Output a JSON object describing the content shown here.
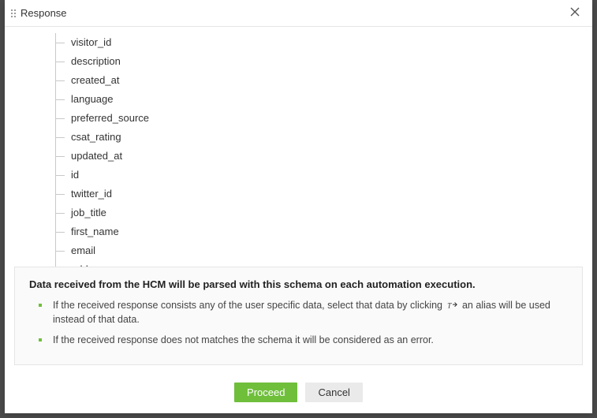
{
  "modal": {
    "title": "Response",
    "tree_items": [
      "visitor_id",
      "description",
      "created_at",
      "language",
      "preferred_source",
      "csat_rating",
      "updated_at",
      "id",
      "twitter_id",
      "job_title",
      "first_name",
      "email",
      "address"
    ],
    "info": {
      "title": "Data received from the HCM will be parsed with this schema on each automation execution.",
      "bullets": [
        {
          "pre": "If the received response consists any of the user specific data, select that data by clicking",
          "post": "an alias will be used instead of that data."
        },
        {
          "pre": "If the received response does not matches the schema it will be considered as an error.",
          "post": ""
        }
      ]
    },
    "buttons": {
      "proceed": "Proceed",
      "cancel": "Cancel"
    }
  }
}
